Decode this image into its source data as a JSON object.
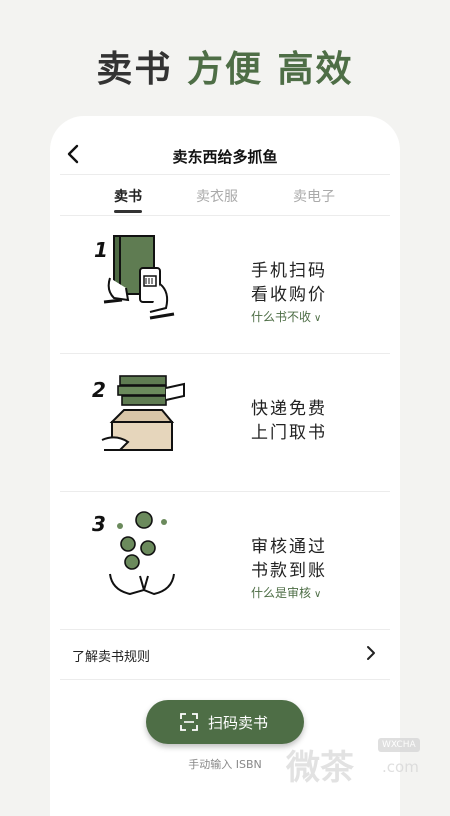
{
  "headline": {
    "part1": "卖书",
    "part2": "方便",
    "part3": "高效"
  },
  "header": {
    "title": "卖东西给多抓鱼"
  },
  "tabs": [
    {
      "label": "卖书",
      "active": true
    },
    {
      "label": "卖衣服",
      "active": false
    },
    {
      "label": "卖电子",
      "active": false
    }
  ],
  "steps": [
    {
      "number": "1",
      "line1": "手机扫码",
      "line2": "看收购价",
      "link": "什么书不收",
      "illustration": "scan-book-phone"
    },
    {
      "number": "2",
      "line1": "快递免费",
      "line2": "上门取书",
      "illustration": "books-in-box"
    },
    {
      "number": "3",
      "line1": "审核通过",
      "line2": "书款到账",
      "link": "什么是审核",
      "illustration": "coins-falling-hands"
    }
  ],
  "rules": {
    "label": "了解卖书规则"
  },
  "scan_button": {
    "label": "扫码卖书",
    "icon": "scan-icon"
  },
  "manual_input": {
    "label": "手动输入 ISBN"
  },
  "watermark": {
    "text": "微茶",
    "tag": "WXCHA",
    "domain": ".com"
  },
  "colors": {
    "accent": "#4e6e46",
    "background": "#f3f3f1"
  }
}
